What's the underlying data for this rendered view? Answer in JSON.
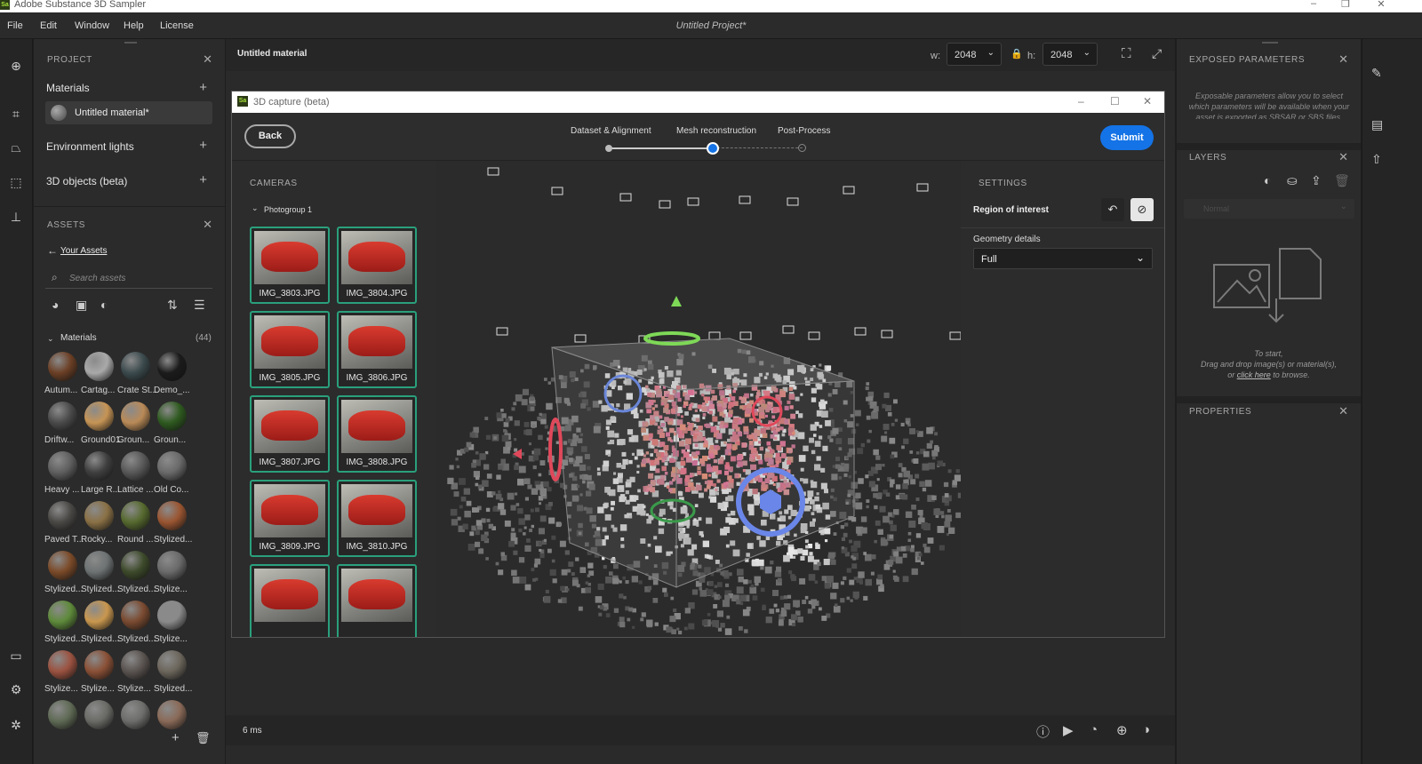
{
  "app": {
    "title": "Adobe Substance 3D Sampler",
    "logo": "Sa",
    "project_title": "Untitled Project*"
  },
  "menu": [
    "File",
    "Edit",
    "Window",
    "Help",
    "License"
  ],
  "project": {
    "header": "PROJECT",
    "materials_label": "Materials",
    "material_item": "Untitled material*",
    "env_label": "Environment lights",
    "objects_label": "3D objects (beta)"
  },
  "assets": {
    "header": "ASSETS",
    "back_label": "Your Assets",
    "search_placeholder": "Search assets",
    "group_label": "Materials",
    "count": "(44)",
    "items": [
      "Autum...",
      "Cartag...",
      "Crate St...",
      "Demo_...",
      "Driftw...",
      "Ground01",
      "Groun...",
      "Groun...",
      "Heavy ...",
      "Large R...",
      "Lattice ...",
      "Old Co...",
      "Paved T...",
      "Rocky...",
      "Round ...",
      "Stylized...",
      "Stylized...",
      "Stylized...",
      "Stylized...",
      "Stylize...",
      "Stylized...",
      "Stylized...",
      "Stylized...",
      "Stylize...",
      "Stylize...",
      "Stylize...",
      "Stylize...",
      "Stylized..."
    ],
    "colors": [
      "#6b3f25",
      "#a9a9a9",
      "#3b4a4d",
      "#1b1b1b",
      "#4a4a4a",
      "#c69455",
      "#b98a57",
      "#2e5a1f",
      "#5f5f5f",
      "#3f3f3f",
      "#585858",
      "#6a6a6a",
      "#4a4845",
      "#8a7045",
      "#56692e",
      "#9a5531",
      "#7b4a28",
      "#6d7272",
      "#3d4a2a",
      "#6a6a6a",
      "#5e8a3a",
      "#c9974e",
      "#7a4a30",
      "#8a8a8a",
      "#9b5240",
      "#8a5036",
      "#5a5350",
      "#6c665c",
      "#5f6a55",
      "#6a6a66",
      "#6d6d6b",
      "#8a6a58"
    ]
  },
  "canvas": {
    "material_title": "Untitled material",
    "w_label": "w:",
    "w_value": "2048",
    "h_label": "h:",
    "h_value": "2048",
    "frame_time": "6 ms"
  },
  "dialog": {
    "title": "3D capture (beta)",
    "back": "Back",
    "submit": "Submit",
    "steps": [
      "Dataset & Alignment",
      "Mesh reconstruction",
      "Post-Process"
    ],
    "cameras_header": "CAMERAS",
    "photogroup": "Photogroup 1",
    "thumbs": [
      "IMG_3803.JPG",
      "IMG_3804.JPG",
      "IMG_3805.JPG",
      "IMG_3806.JPG",
      "IMG_3807.JPG",
      "IMG_3808.JPG",
      "IMG_3809.JPG",
      "IMG_3810.JPG",
      "",
      ""
    ],
    "settings_header": "SETTINGS",
    "roi_label": "Region of interest",
    "geo_label": "Geometry details",
    "geo_value": "Full"
  },
  "right": {
    "exposed_header": "EXPOSED PARAMETERS",
    "exposed_text1": "Exposable parameters allow you to select",
    "exposed_text2": "which parameters will be available when your",
    "exposed_text3": "asset is exported as SBSAR or SBS files.",
    "layers_header": "LAYERS",
    "blend_mode": "Normal",
    "drop_line1": "To start,",
    "drop_line2": "Drag and drop image(s) or material(s),",
    "drop_or": "or",
    "drop_link": "click here",
    "drop_end": "to browse.",
    "properties_header": "PROPERTIES"
  },
  "colors": {
    "accent": "#1473e6",
    "thumb_border": "#2aa07c"
  }
}
